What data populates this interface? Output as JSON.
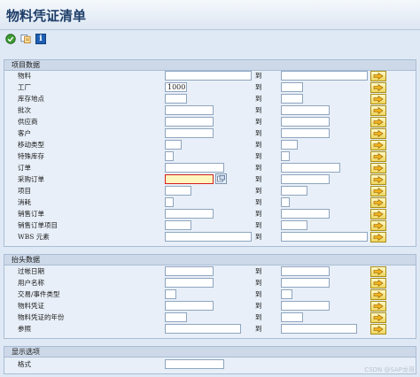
{
  "title": "物料凭证清单",
  "toolbar": {
    "execute_icon": "execute-icon",
    "variant_icon": "get-variant-icon",
    "info_icon": "info-icon",
    "info_glyph": "i"
  },
  "range_to": "到",
  "groups": {
    "project": {
      "header": "项目数据",
      "rows": [
        {
          "label": "物料",
          "low": "",
          "high": ""
        },
        {
          "label": "工厂",
          "low": "1000",
          "high": ""
        },
        {
          "label": "库存地点",
          "low": "",
          "high": ""
        },
        {
          "label": "批次",
          "low": "",
          "high": ""
        },
        {
          "label": "供应商",
          "low": "",
          "high": ""
        },
        {
          "label": "客户",
          "low": "",
          "high": ""
        },
        {
          "label": "移动类型",
          "low": "",
          "high": ""
        },
        {
          "label": "特殊库存",
          "low": "",
          "high": ""
        },
        {
          "label": "订单",
          "low": "",
          "high": ""
        },
        {
          "label": "采购订单",
          "low": "",
          "high": ""
        },
        {
          "label": "项目",
          "low": "",
          "high": ""
        },
        {
          "label": "消耗",
          "low": "",
          "high": ""
        },
        {
          "label": "销售订单",
          "low": "",
          "high": ""
        },
        {
          "label": "销售订单项目",
          "low": "",
          "high": ""
        },
        {
          "label": "WBS 元素",
          "low": "",
          "high": ""
        }
      ]
    },
    "header_data": {
      "header": "抬头数据",
      "rows": [
        {
          "label": "过帐日期",
          "low": "",
          "high": ""
        },
        {
          "label": "用户名称",
          "low": "",
          "high": ""
        },
        {
          "label": "交易/事件类型",
          "low": "",
          "high": ""
        },
        {
          "label": "物料凭证",
          "low": "",
          "high": ""
        },
        {
          "label": "物料凭证的年份",
          "low": "",
          "high": ""
        },
        {
          "label": "参照",
          "low": "",
          "high": ""
        }
      ]
    },
    "display": {
      "header": "显示选项",
      "rows": [
        {
          "label": "格式",
          "low": ""
        }
      ]
    }
  },
  "watermark": "CSDN @SAP龙哥",
  "colors": {
    "accent": "#1f3f6a",
    "active_field": "#fff6bd",
    "active_border": "#d51f1f",
    "multi_button": "#efd55a"
  }
}
